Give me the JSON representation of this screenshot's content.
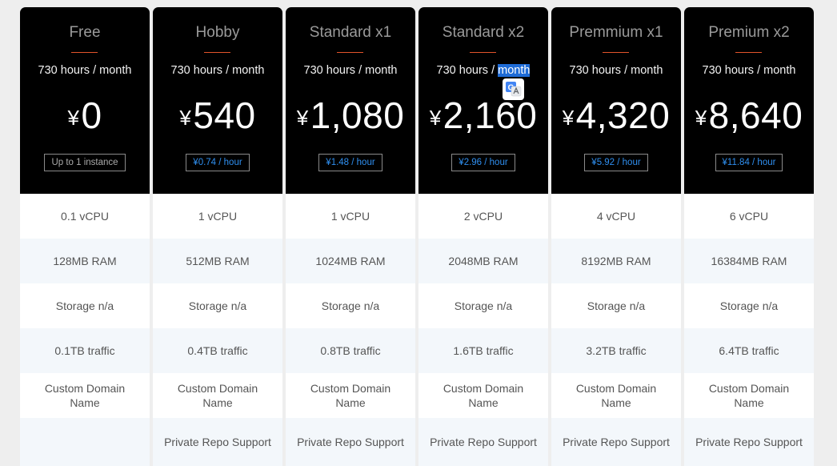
{
  "currency_symbol": "¥",
  "plans": [
    {
      "name": "Free",
      "hours": "730 hours / month",
      "price": "0",
      "rate": "Up to 1 instance",
      "cpu": "0.1 vCPU",
      "ram": "128MB RAM",
      "storage": "Storage n/a",
      "traffic": "0.1TB traffic",
      "domain": "Custom Domain Name",
      "repo": ""
    },
    {
      "name": "Hobby",
      "hours": "730 hours / month",
      "price": "540",
      "rate": "¥0.74 / hour",
      "cpu": "1 vCPU",
      "ram": "512MB RAM",
      "storage": "Storage n/a",
      "traffic": "0.4TB traffic",
      "domain": "Custom Domain Name",
      "repo": "Private Repo Support"
    },
    {
      "name": "Standard x1",
      "hours": "730 hours / month",
      "price": "1,080",
      "rate": "¥1.48 / hour",
      "cpu": "1 vCPU",
      "ram": "1024MB RAM",
      "storage": "Storage n/a",
      "traffic": "0.8TB traffic",
      "domain": "Custom Domain Name",
      "repo": "Private Repo Support"
    },
    {
      "name": "Standard x2",
      "hours_prefix": "730 hours / ",
      "hours_highlight": "month",
      "price": "2,160",
      "rate": "¥2.96 / hour",
      "cpu": "2 vCPU",
      "ram": "2048MB RAM",
      "storage": "Storage n/a",
      "traffic": "1.6TB traffic",
      "domain": "Custom Domain Name",
      "repo": "Private Repo Support"
    },
    {
      "name": "Premmium x1",
      "hours": "730 hours / month",
      "price": "4,320",
      "rate": "¥5.92 / hour",
      "cpu": "4 vCPU",
      "ram": "8192MB RAM",
      "storage": "Storage n/a",
      "traffic": "3.2TB traffic",
      "domain": "Custom Domain Name",
      "repo": "Private Repo Support"
    },
    {
      "name": "Premium x2",
      "hours": "730 hours / month",
      "price": "8,640",
      "rate": "¥11.84 / hour",
      "cpu": "6 vCPU",
      "ram": "16384MB RAM",
      "storage": "Storage n/a",
      "traffic": "6.4TB traffic",
      "domain": "Custom Domain Name",
      "repo": "Private Repo Support"
    }
  ],
  "colors": {
    "accent_rule": "#e2542a",
    "link_blue": "#2f8ff0",
    "selection_blue": "#1e6bd6"
  },
  "overlay": {
    "icon": "google-translate-icon"
  }
}
